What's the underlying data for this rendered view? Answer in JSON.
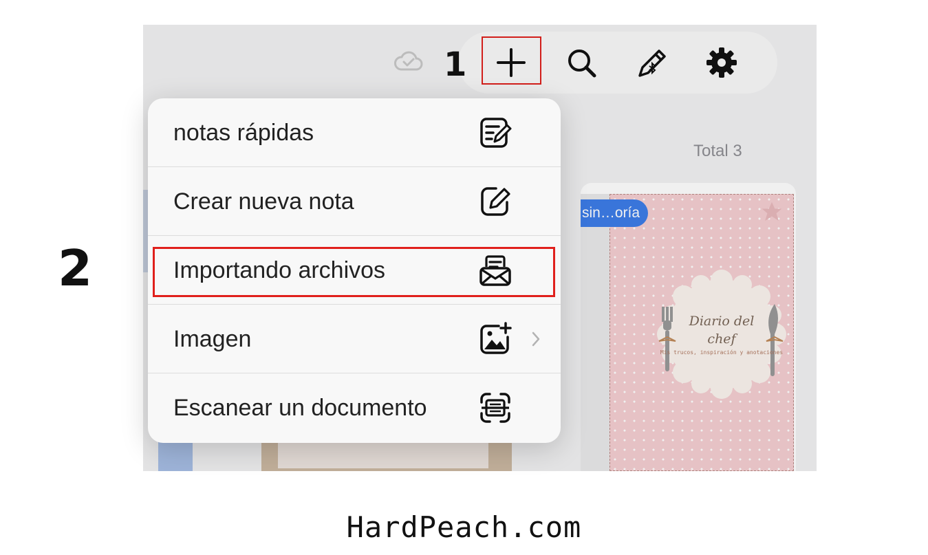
{
  "annotations": {
    "step_one": "1",
    "step_two": "2"
  },
  "toolbar": {
    "icons": [
      "cloud-sync-icon",
      "plus-icon",
      "search-icon",
      "bluetooth-pen-icon",
      "gear-icon"
    ]
  },
  "library": {
    "total_label": "Total 3",
    "notebook": {
      "badge": "sin…oría",
      "cover_title": "Diario del\nchef",
      "cover_subtitle": "Mis trucos, inspiración y anotaciones"
    }
  },
  "menu": {
    "items": [
      {
        "label": "notas rápidas",
        "icon": "quick-note-icon"
      },
      {
        "label": "Crear nueva nota",
        "icon": "new-note-icon"
      },
      {
        "label": "Importando archivos",
        "icon": "import-file-icon"
      },
      {
        "label": "Imagen",
        "icon": "add-image-icon",
        "has_submenu": true
      },
      {
        "label": "Escanear un documento",
        "icon": "scan-document-icon"
      }
    ]
  },
  "colors": {
    "highlight": "#e0201c",
    "badge": "#3d7de8",
    "cover": "#f5cfd2"
  },
  "watermark": "HardPeach.com"
}
